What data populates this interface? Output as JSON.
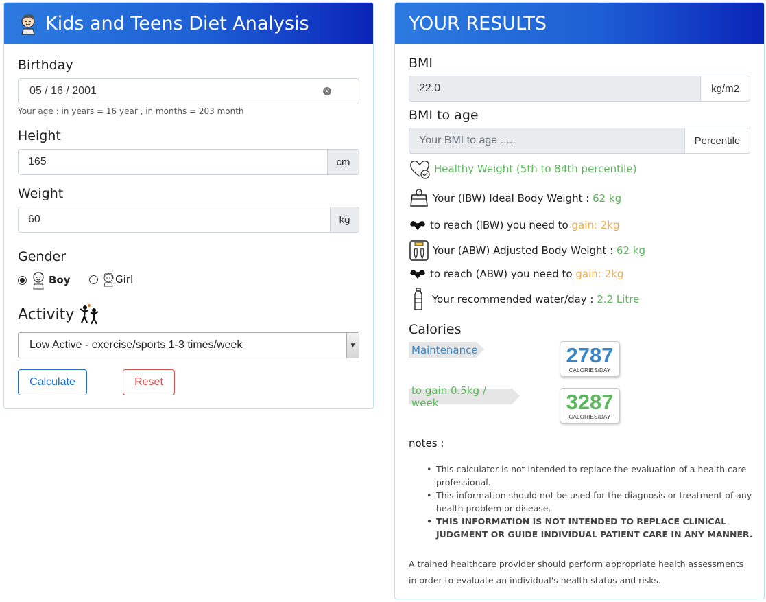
{
  "left_panel": {
    "title": "Kids and Teens Diet Analysis",
    "birthday": {
      "label": "Birthday",
      "date_value": "05 / 16 / 2001",
      "age_note": "Your age : in years = 16 year , in months = 203 month"
    },
    "height": {
      "label": "Height",
      "value": "165",
      "unit": "cm"
    },
    "weight": {
      "label": "Weight",
      "value": "60",
      "unit": "kg"
    },
    "gender": {
      "label": "Gender",
      "options": [
        {
          "label": "Boy",
          "selected": true
        },
        {
          "label": "Girl",
          "selected": false
        }
      ]
    },
    "activity": {
      "label": "Activity",
      "selected": "Low Active - exercise/sports 1-3 times/week"
    },
    "buttons": {
      "calculate": "Calculate",
      "reset": "Reset"
    }
  },
  "right_panel": {
    "title": "YOUR RESULTS",
    "bmi": {
      "label": "BMI",
      "value": "22.0",
      "unit": "kg/m2"
    },
    "bmi_to_age": {
      "label": "BMI to age",
      "placeholder": "Your BMI to age .....",
      "unit": "Percentile"
    },
    "status": "Healthy Weight (5th to 84th percentile)",
    "ibw": {
      "prefix": "Your (IBW) Ideal Body Weight : ",
      "value": "62 kg"
    },
    "ibw_reach": {
      "prefix": "to reach (IBW) you need to ",
      "value": "gain: 2kg"
    },
    "abw": {
      "prefix": "Your (ABW) Adjusted Body Weight : ",
      "value": "62 kg"
    },
    "abw_reach": {
      "prefix": "to reach (ABW) you need to ",
      "value": "gain: 2kg"
    },
    "water": {
      "prefix": "Your recommended water/day : ",
      "value": "2.2 Litre"
    },
    "calories": {
      "label": "Calories",
      "maintenance": {
        "label": "Maintenance",
        "value": "2787",
        "unit": "CALORIES/DAY"
      },
      "gain": {
        "label": "to gain 0.5kg / week",
        "value": "3287",
        "unit": "CALORIES/DAY"
      }
    },
    "notes": {
      "title": "notes :",
      "items": [
        "This calculator is not intended to replace the evaluation of a health care professional.",
        "This information should not be used for the diagnosis or treatment of any health problem or disease.",
        "THIS INFORMATION IS NOT INTENDED TO REPLACE CLINICAL JUDGMENT OR GUIDE INDIVIDUAL PATIENT CARE IN ANY MANNER."
      ],
      "footer": "A trained healthcare provider should perform appropriate health assessments in order to evaluate an individual's health status and risks."
    }
  },
  "colors": {
    "header_gradient_start": "#2c7be0",
    "header_gradient_end": "#0a24b8",
    "healthy_green": "#5cb85c",
    "gain_orange": "#f0ad4e",
    "maintenance_blue": "#3a87c8",
    "calc_button_blue": "#1f6fc5",
    "reset_button_red": "#d9534f"
  },
  "icons": {
    "header": "boy-face-icon",
    "status": "heart-check-icon",
    "ibw": "scale-icon",
    "reach": "muscle-arm-icon",
    "abw": "weighing-scale-feet-icon",
    "water": "water-bottle-icon",
    "activity": "dancing-kids-icon"
  }
}
